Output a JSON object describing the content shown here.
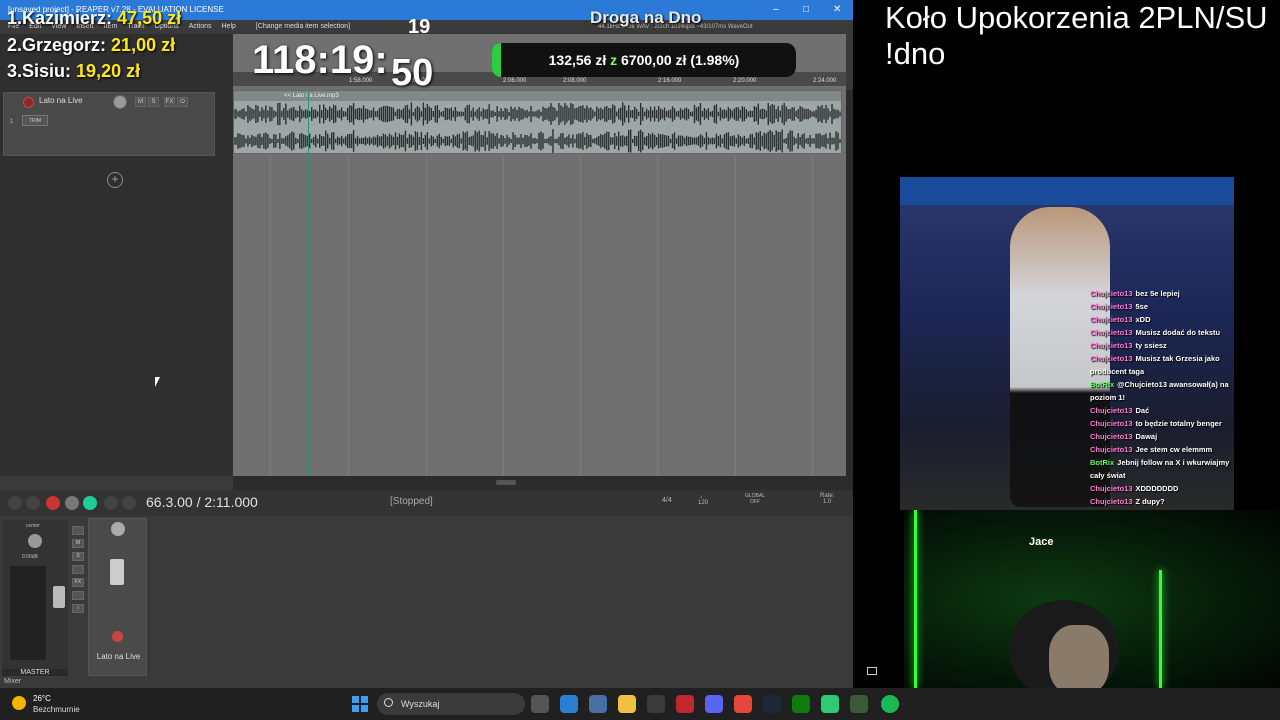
{
  "window": {
    "title": "[unsaved project] - REAPER v7.28 - EVALUATION LICENSE",
    "status": "44.1kHz 24bit WAV : 2/2ch 1024spls ~43/107ms WaveOut"
  },
  "menu": {
    "items": [
      "File",
      "Edit",
      "View",
      "Insert",
      "Item",
      "Track",
      "Options",
      "Actions",
      "Help"
    ],
    "context": "[Change media item selection]"
  },
  "track": {
    "name": "Lato na Live",
    "number": "1",
    "trim": "TRIM",
    "buttons": [
      "M",
      "S",
      "FX"
    ]
  },
  "item": {
    "name": "<< Lato na Live.mp3"
  },
  "ruler": {
    "marks": [
      "1:58.000",
      "2:00.000",
      "2:06.000",
      "2:08.000",
      "2:16.000",
      "2:20.000",
      "2:24.000"
    ]
  },
  "transport": {
    "timecode": "66.3.00 / 2:11.000",
    "state": "[Stopped]",
    "time_signature": "4/4",
    "tempo": "120",
    "global_label": "GLOBAL",
    "global_value": "OFF",
    "rate_label": "Rate:",
    "rate_value": "1.0"
  },
  "mixer": {
    "master_label": "MASTER",
    "master_pan": "center",
    "master_db": "0.00dB",
    "route": "ROUTE",
    "trim": "TRIM",
    "strip_name": "Lato na Live",
    "tab": "Mixer"
  },
  "overlay": {
    "donors": [
      {
        "rank": "1.",
        "name": "Kazimierz:",
        "amount": "47,50 zł"
      },
      {
        "rank": "2.",
        "name": "Grzegorz:",
        "amount": "21,00 zł"
      },
      {
        "rank": "3.",
        "name": "Sisiu:",
        "amount": "19,20 zł"
      }
    ],
    "timer_main": "118:19:",
    "timer_sec": "50",
    "timer_top": "19",
    "goal_current": "132,56 zł",
    "goal_mid": "z",
    "goal_target": "6700,00 zł",
    "goal_pct": "(1.98%)",
    "goal_fraction": 0.0198,
    "stream_title": "Droga na Dno"
  },
  "right": {
    "ticker": "Koło Upokorzenia 2PLN/SU",
    "ticker2": "!dno",
    "webcam_label": "Jace",
    "chat": [
      {
        "user": "Chujcieto13",
        "msg": "bez 5e lepiej"
      },
      {
        "user": "Chujcieto13",
        "msg": "5se"
      },
      {
        "user": "Chujcieto13",
        "msg": "xDD"
      },
      {
        "user": "Chujcieto13",
        "msg": "Musisz dodać do tekstu"
      },
      {
        "user": "Chujcieto13",
        "msg": "ty ssiesz"
      },
      {
        "user": "Chujcieto13",
        "msg": "Musisz tak Grzesia jako producent taga"
      },
      {
        "user": "BotRix",
        "msg": "@Chujcieto13 awansował(a) na poziom 1!",
        "bot": true
      },
      {
        "user": "Chujcieto13",
        "msg": "Dać"
      },
      {
        "user": "Chujcieto13",
        "msg": "to będzie totalny benger"
      },
      {
        "user": "Chujcieto13",
        "msg": "Dawaj"
      },
      {
        "user": "Chujcieto13",
        "msg": "Jee stem cw elemmm"
      },
      {
        "user": "BotRix",
        "msg": "Jebnij follow na X i wkurwiajmy cały świat",
        "bot": true
      },
      {
        "user": "Chujcieto13",
        "msg": "XDDDDDDD"
      },
      {
        "user": "Chujcieto13",
        "msg": "Z dupy?"
      }
    ]
  },
  "taskbar": {
    "temp": "26°C",
    "weather": "Bezchmurnie",
    "search_placeholder": "Wyszukaj"
  }
}
